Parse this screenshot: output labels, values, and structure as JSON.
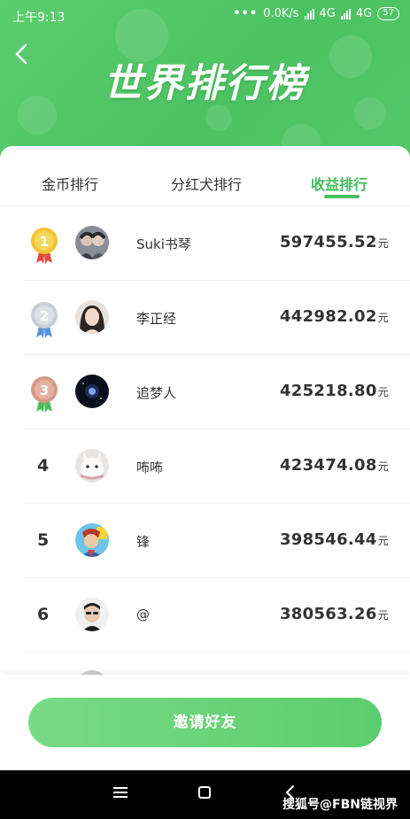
{
  "status_bar": {
    "time": "上午9:13",
    "dots": "•••",
    "speed": "0.0K/s",
    "network1": "4G",
    "network2": "4G",
    "battery": "57"
  },
  "header": {
    "title": "世界排行榜"
  },
  "tabs": [
    {
      "label": "金币排行",
      "active": false
    },
    {
      "label": "分红犬排行",
      "active": false
    },
    {
      "label": "收益排行",
      "active": true
    }
  ],
  "ranking": [
    {
      "rank": "1",
      "name": "Suki书琴",
      "amount": "597455.52",
      "unit": "元",
      "medal": "gold-medal"
    },
    {
      "rank": "2",
      "name": "李正经",
      "amount": "442982.02",
      "unit": "元",
      "medal": "silver-medal"
    },
    {
      "rank": "3",
      "name": "追梦人",
      "amount": "425218.80",
      "unit": "元",
      "medal": "bronze-medal"
    },
    {
      "rank": "4",
      "name": "咘咘",
      "amount": "423474.08",
      "unit": "元"
    },
    {
      "rank": "5",
      "name": "锋",
      "amount": "398546.44",
      "unit": "元"
    },
    {
      "rank": "6",
      "name": "@",
      "amount": "380563.26",
      "unit": "元"
    }
  ],
  "invite_button": {
    "label": "邀请好友"
  },
  "watermark": "搜狐号@FBN链视界",
  "colors": {
    "brand_green": "#4cc262",
    "active_tab": "#3fbd58",
    "gold": "#f2c230",
    "silver": "#c9ced6",
    "bronze": "#d79a86"
  }
}
